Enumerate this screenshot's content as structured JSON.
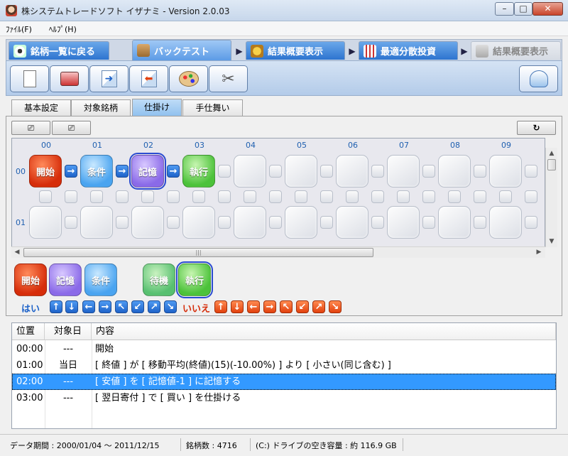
{
  "window": {
    "title": "株システムトレードソフト イザナミ - Version 2.0.03"
  },
  "menu": [
    {
      "label": "ﾌｧｲﾙ(F)"
    },
    {
      "label": "ﾍﾙﾌﾟ(H)"
    }
  ],
  "main_tabs": [
    {
      "label": "銘柄一覧に戻る",
      "state": "normal",
      "icon": "eye-icon"
    },
    {
      "label": "バックテスト",
      "state": "active",
      "icon": "bag-icon"
    },
    {
      "label": "結果概要表示",
      "state": "normal",
      "icon": "money-icon"
    },
    {
      "label": "最適分散投資",
      "state": "normal",
      "icon": "calculator-icon"
    },
    {
      "label": "結果概要表示",
      "state": "disabled",
      "icon": "building-icon"
    }
  ],
  "toolbar": {
    "icons": [
      "new-document-icon",
      "open-icon",
      "export-icon",
      "import-icon",
      "palette-icon",
      "tools-icon"
    ],
    "right_icon": "toilet-icon"
  },
  "sub_tabs": [
    {
      "label": "基本設定",
      "active": false
    },
    {
      "label": "対象銘柄",
      "active": false
    },
    {
      "label": "仕掛け",
      "active": true
    },
    {
      "label": "手仕舞い",
      "active": false
    }
  ],
  "grid": {
    "col_headers": [
      "00",
      "01",
      "02",
      "03",
      "04",
      "05",
      "06",
      "07",
      "08",
      "09"
    ],
    "row_headers": [
      "00",
      "01"
    ],
    "row0_blocks": [
      {
        "label": "開始",
        "kind": "start"
      },
      {
        "label": "条件",
        "kind": "cond"
      },
      {
        "label": "記憶",
        "kind": "mem"
      },
      {
        "label": "執行",
        "kind": "exec"
      }
    ]
  },
  "palette": {
    "blocks": [
      {
        "label": "開始",
        "kind": "start"
      },
      {
        "label": "記憶",
        "kind": "mem"
      },
      {
        "label": "条件",
        "kind": "cond"
      },
      {
        "label": "待機",
        "kind": "wait"
      },
      {
        "label": "執行",
        "kind": "exec"
      }
    ],
    "yes_label": "はい",
    "no_label": "いいえ",
    "arrows": [
      "↑",
      "↓",
      "←",
      "→",
      "↖",
      "↙",
      "↗",
      "↘"
    ]
  },
  "list": {
    "headers": [
      "位置",
      "対象日",
      "内容"
    ],
    "rows": [
      {
        "pos": "00:00",
        "day": "---",
        "content": "開始",
        "selected": false
      },
      {
        "pos": "01:00",
        "day": "当日",
        "content": "[ 終値 ] が [ 移動平均(終値)(15)(-10.00%) ] より [ 小さい(同じ含む) ]",
        "selected": false
      },
      {
        "pos": "02:00",
        "day": "---",
        "content": "[ 安値 ] を [ 記憶値-1 ] に記憶する",
        "selected": true
      },
      {
        "pos": "03:00",
        "day": "---",
        "content": "[ 翌日寄付 ] で [ 買い ] を仕掛ける",
        "selected": false
      }
    ]
  },
  "status": {
    "period": "データ期間 : 2000/01/04 〜 2011/12/15",
    "count": "銘柄数 : 4716",
    "disk": "(C:) ドライブの空き容量 : 約 116.9 GB"
  },
  "colors": {
    "tab_blue": "#2d74cf",
    "selection": "#3399ff",
    "start_block": "#d62d0a",
    "cond_block": "#4aa4f0",
    "mem_block": "#8a6ae8",
    "exec_block": "#4cc23a"
  }
}
